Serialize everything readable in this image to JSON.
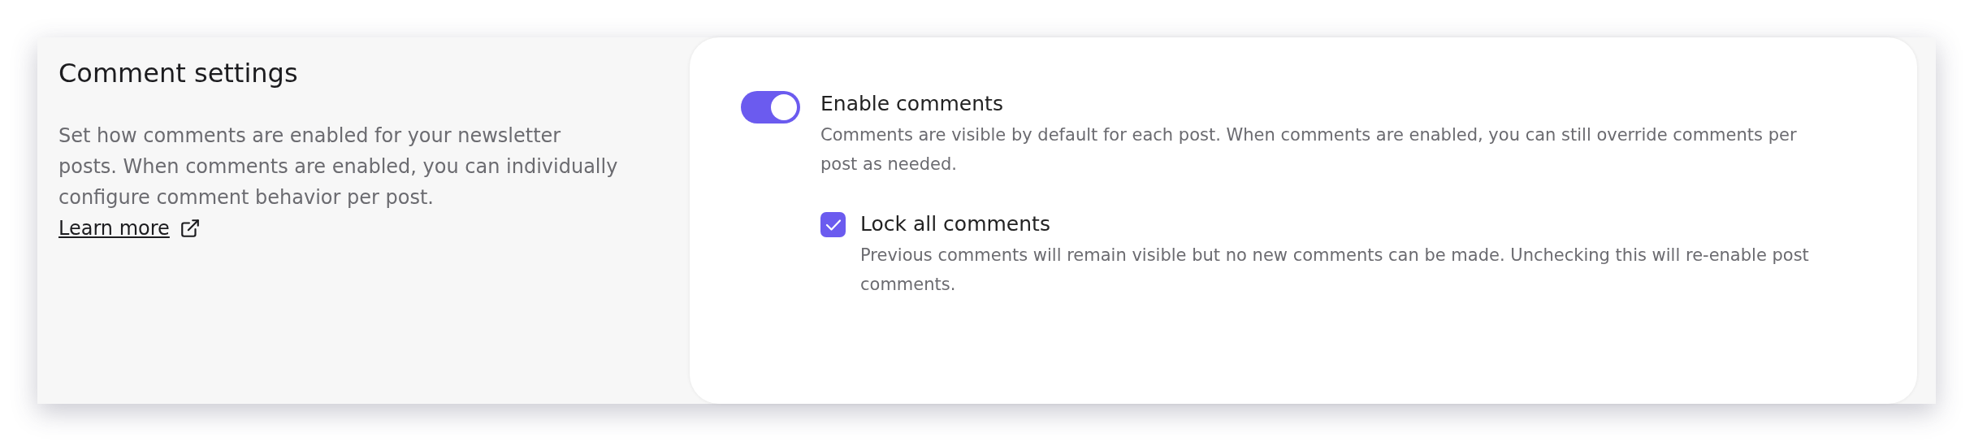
{
  "section": {
    "title": "Comment settings",
    "description": "Set how comments are enabled for your newsletter posts. When comments are enabled, you can individually configure comment behavior per post.",
    "link": "Learn more"
  },
  "settings": [
    {
      "kind": "toggle",
      "label": "Enable comments",
      "description": "Comments are visible by default for each post. When comments are enabled, you can still override comments per post as needed.",
      "on": true,
      "children": [
        {
          "kind": "checkbox",
          "label": "Lock all comments",
          "description": "Previous comments will remain visible but no new comments can be made. Unchecking this will re-enable post comments.",
          "checked": true
        }
      ]
    }
  ]
}
